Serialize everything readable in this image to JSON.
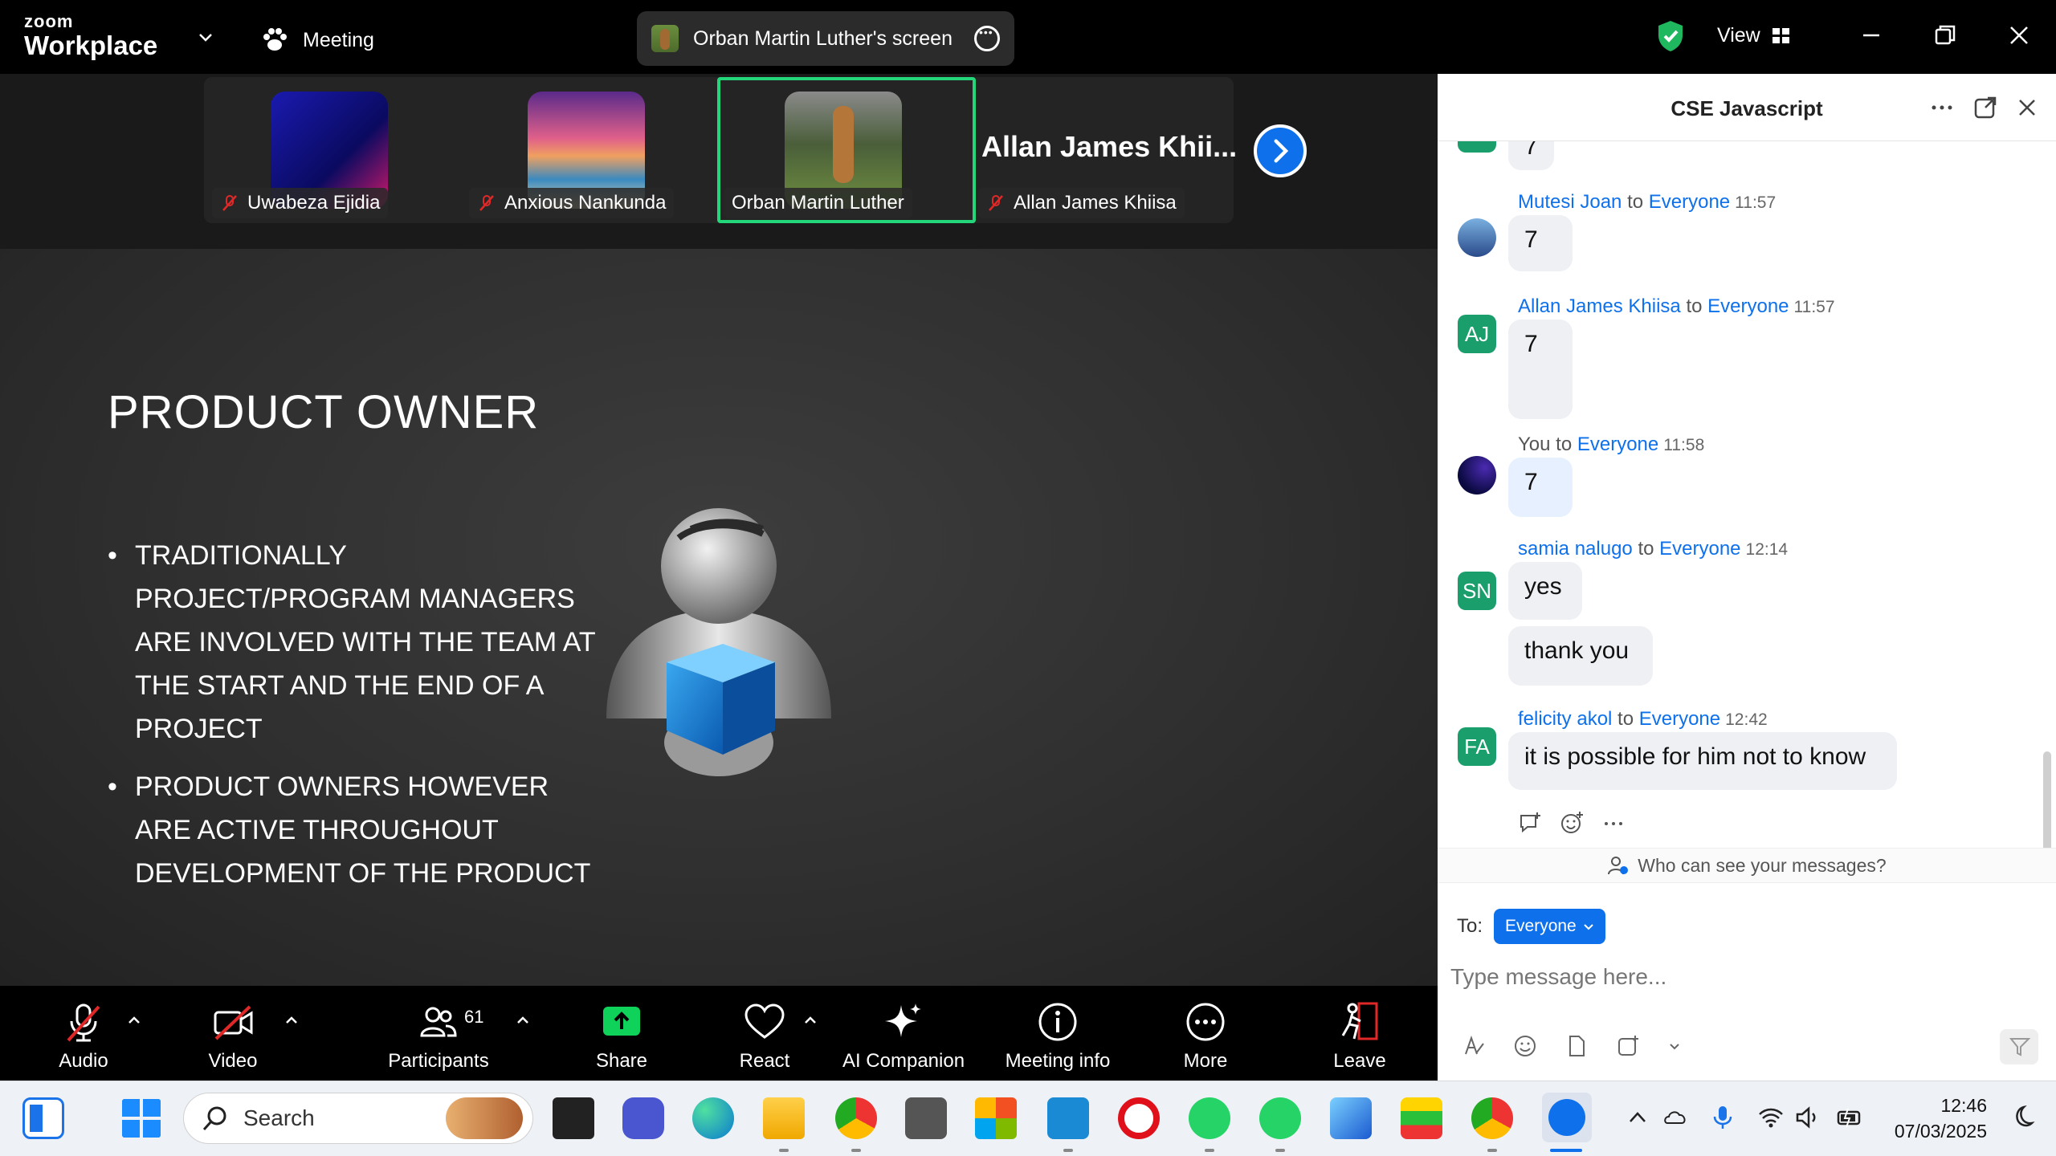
{
  "app": {
    "brand_small": "zoom",
    "brand_big": "Workplace",
    "meeting_label": "Meeting",
    "share_label": "Orban Martin Luther's screen",
    "view_label": "View"
  },
  "participants_strip": [
    {
      "name": "Uwabeza Ejidia",
      "muted": true
    },
    {
      "name": "Anxious Nankunda",
      "muted": true
    },
    {
      "name": "Orban Martin Luther",
      "muted": false,
      "active": true
    },
    {
      "name": "Allan James Khiisa",
      "muted": true,
      "display_big": "Allan James Khii..."
    }
  ],
  "slide": {
    "title": "PRODUCT OWNER",
    "bullets": [
      "TRADITIONALLY PROJECT/PROGRAM MANAGERS ARE INVOLVED WITH THE TEAM AT THE START AND THE END OF A PROJECT",
      "PRODUCT OWNERS HOWEVER ARE ACTIVE THROUGHOUT DEVELOPMENT OF THE PRODUCT"
    ]
  },
  "toolbar": {
    "audio": "Audio",
    "video": "Video",
    "participants": "Participants",
    "participants_count": "61",
    "share": "Share",
    "react": "React",
    "ai": "AI Companion",
    "info": "Meeting info",
    "more": "More",
    "leave": "Leave"
  },
  "chat": {
    "title": "CSE Javascript",
    "partial_top": "7",
    "to_word": "to",
    "messages": [
      {
        "sender": "Mutesi Joan",
        "to": "Everyone",
        "time": "11:57",
        "text": "7"
      },
      {
        "sender": "Allan James Khiisa",
        "initials": "AJ",
        "to": "Everyone",
        "time": "11:57",
        "text": "7"
      },
      {
        "sender": "You",
        "to": "Everyone",
        "time": "11:58",
        "text": "7"
      },
      {
        "sender": "samia nalugo",
        "initials": "SN",
        "to": "Everyone",
        "time": "12:14",
        "text": "yes",
        "text2": "thank you"
      },
      {
        "sender": "felicity akol",
        "initials": "FA",
        "to": "Everyone",
        "time": "12:42",
        "text": "it is possible for him not to know"
      }
    ],
    "privacy_note": "Who can see your messages?",
    "to_label": "To:",
    "recipient": "Everyone",
    "input_placeholder": "Type message here..."
  },
  "taskbar": {
    "search_placeholder": "Search",
    "time": "12:46",
    "date": "07/03/2025"
  },
  "colors": {
    "accent": "#0e71eb",
    "active_border": "#24d67a",
    "avatar_green": "#1a9e6b",
    "share_green": "#0fd25b",
    "leave_red": "#e02828"
  }
}
